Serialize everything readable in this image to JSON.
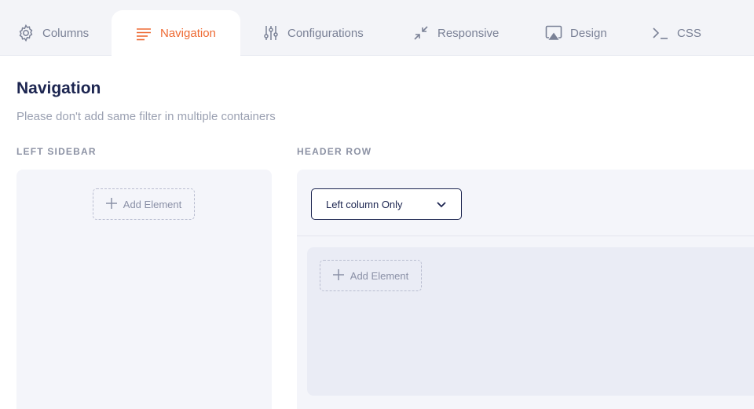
{
  "tabs": [
    {
      "label": "Columns",
      "icon": "gear-icon",
      "active": false
    },
    {
      "label": "Navigation",
      "icon": "menu-lines-icon",
      "active": true
    },
    {
      "label": "Configurations",
      "icon": "sliders-icon",
      "active": false
    },
    {
      "label": "Responsive",
      "icon": "collapse-arrows-icon",
      "active": false
    },
    {
      "label": "Design",
      "icon": "screen-cast-icon",
      "active": false
    },
    {
      "label": "CSS",
      "icon": "terminal-prompt-icon",
      "active": false
    }
  ],
  "page": {
    "title": "Navigation",
    "subtitle": "Please don't add same filter in multiple containers"
  },
  "left_sidebar": {
    "label": "LEFT SIDEBAR",
    "add_button": "Add Element"
  },
  "header_row": {
    "label": "HEADER ROW",
    "select_value": "Left column Only",
    "add_button": "Add Element"
  },
  "colors": {
    "accent": "#ee6a33",
    "heading": "#1c2550",
    "muted": "#7a8196",
    "panel_bg": "#f4f5fa",
    "tabbar_bg": "#f3f4f8"
  }
}
